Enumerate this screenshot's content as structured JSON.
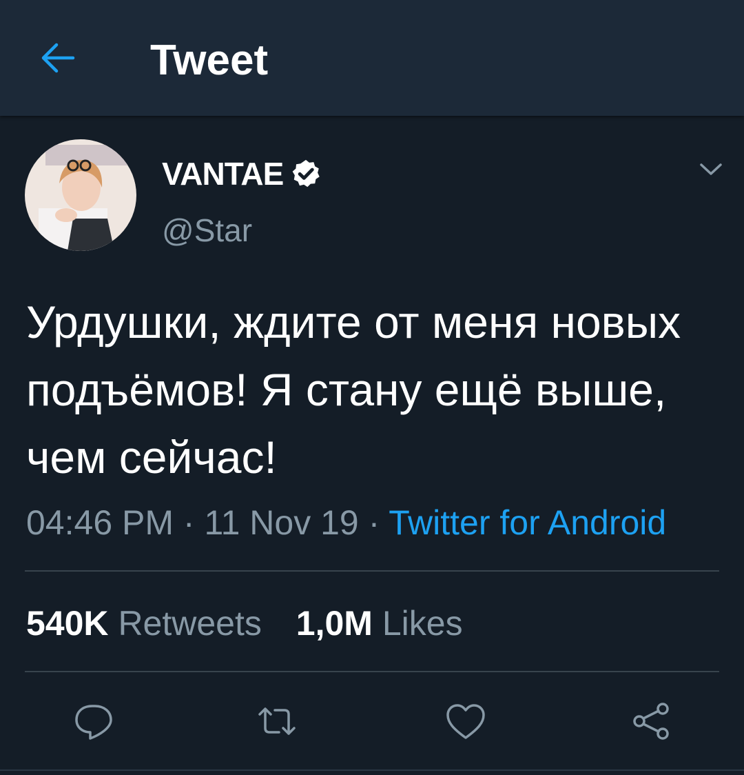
{
  "header": {
    "title": "Tweet",
    "back_icon": "arrow-left-icon"
  },
  "tweet": {
    "author": {
      "display_name": "VANTAE",
      "handle": "@Star",
      "verified_icon": "verified-badge-icon"
    },
    "text": "Урдушки, ждите от меня новых подъёмов! Я стану ещё выше, чем сейчас!",
    "time": "04:46 PM",
    "date": "11 Nov 19",
    "separator": "·",
    "source": "Twitter for Android"
  },
  "stats": {
    "retweets_count": "540K",
    "retweets_label": "Retweets",
    "likes_count": "1,0M",
    "likes_label": "Likes"
  },
  "actions": {
    "reply_icon": "reply-icon",
    "retweet_icon": "retweet-icon",
    "like_icon": "heart-icon",
    "share_icon": "share-icon"
  },
  "colors": {
    "background": "#141d27",
    "header_background": "#1c2938",
    "accent": "#1da1f2",
    "secondary_text": "#8899a6",
    "divider": "#38444d"
  }
}
